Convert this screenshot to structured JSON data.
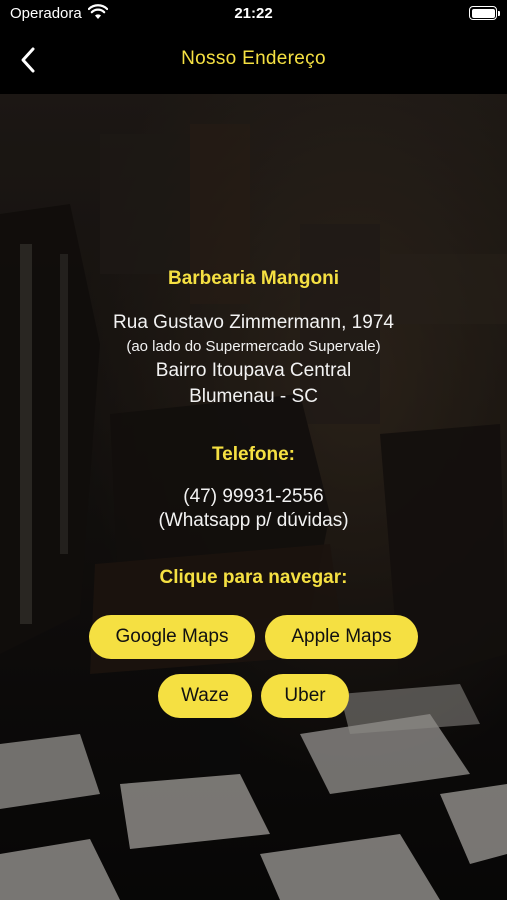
{
  "status_bar": {
    "carrier": "Operadora",
    "time": "21:22"
  },
  "nav": {
    "title": "Nosso Endereço"
  },
  "business": {
    "name": "Barbearia Mangoni"
  },
  "address": {
    "street": "Rua Gustavo Zimmermann, 1974",
    "reference": "(ao lado do Supermercado Supervale)",
    "district": "Bairro Itoupava Central",
    "city": "Blumenau - SC"
  },
  "phone": {
    "label": "Telefone:",
    "number": "(47) 99931-2556",
    "note": "(Whatsapp p/ dúvidas)"
  },
  "navigation": {
    "label": "Clique para navegar:",
    "google_maps": "Google Maps",
    "apple_maps": "Apple Maps",
    "waze": "Waze",
    "uber": "Uber"
  },
  "colors": {
    "accent": "#f5e042",
    "background": "#000000"
  }
}
